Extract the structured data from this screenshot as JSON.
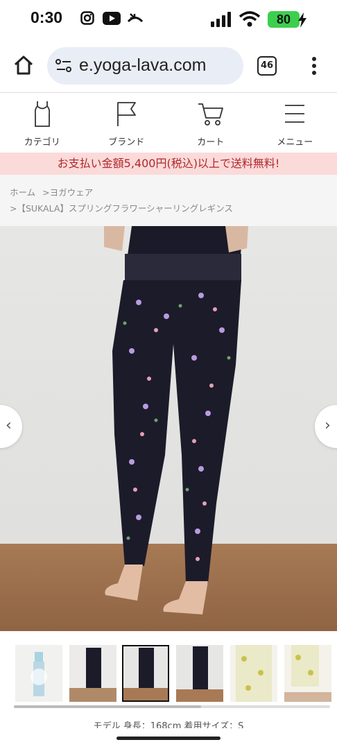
{
  "status_bar": {
    "time": "0:30",
    "battery": "80",
    "icons": [
      "instagram-icon",
      "youtube-icon",
      "missed-call-icon",
      "signal-icon",
      "wifi-icon",
      "charging-icon"
    ]
  },
  "browser": {
    "url": "e.yoga-lava.com",
    "tab_count": "46"
  },
  "site_nav": {
    "items": [
      {
        "label": "カテゴリ",
        "icon": "tank-top-icon"
      },
      {
        "label": "ブランド",
        "icon": "flag-icon"
      },
      {
        "label": "カート",
        "icon": "cart-icon"
      },
      {
        "label": "メニュー",
        "icon": "hamburger-icon"
      }
    ]
  },
  "banner": {
    "text": "お支払い金額5,400円(税込)以上で送料無料!"
  },
  "breadcrumb": {
    "home": "ホーム",
    "category": ">ヨガウェア",
    "product": ">【SUKALA】スプリングフラワーシャーリングレギンス"
  },
  "gallery": {
    "thumbnail_count": 6,
    "active_thumbnail": 3
  },
  "model_info": "モデル 身長：168cm 着用サイズ：S",
  "colors": {
    "banner_bg": "#fbdada",
    "banner_text": "#b0282a",
    "battery": "#3ccf4e"
  }
}
